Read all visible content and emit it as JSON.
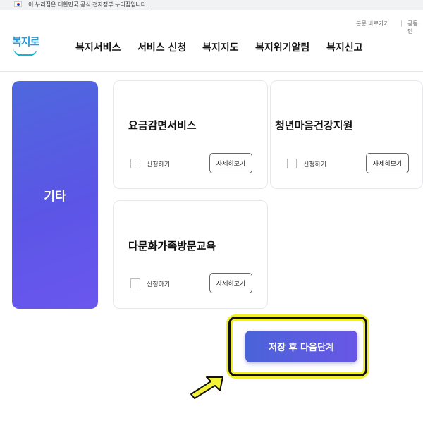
{
  "gov_banner": {
    "text": "이 누리집은 대한민국 공식 전자정부 누리집입니다."
  },
  "utility": {
    "skip_link": "본문 바로가기",
    "cert_link": "공동인"
  },
  "logo": {
    "text": "복지로"
  },
  "nav": {
    "items": [
      "복지서비스",
      "서비스 신청",
      "복지지도",
      "복지위기알림",
      "복지신고"
    ]
  },
  "category": {
    "label": "기타"
  },
  "cards": [
    {
      "title": "요금감면서비스",
      "apply_label": "신청하기",
      "detail_label": "자세히보기"
    },
    {
      "title": "청년마음건강지원",
      "apply_label": "신청하기",
      "detail_label": "자세히보기"
    },
    {
      "title": "다문화가족방문교육",
      "apply_label": "신청하기",
      "detail_label": "자세히보기"
    }
  ],
  "save_button": {
    "label": "저장 후 다음단계"
  },
  "colors": {
    "primary": "#5b5fe3",
    "highlight_yellow": "#f2ef2c",
    "arrow_yellow": "#f5f23a"
  },
  "icons": {
    "flag": "korea-flag-icon",
    "pointer": "pointer-arrow-icon"
  }
}
